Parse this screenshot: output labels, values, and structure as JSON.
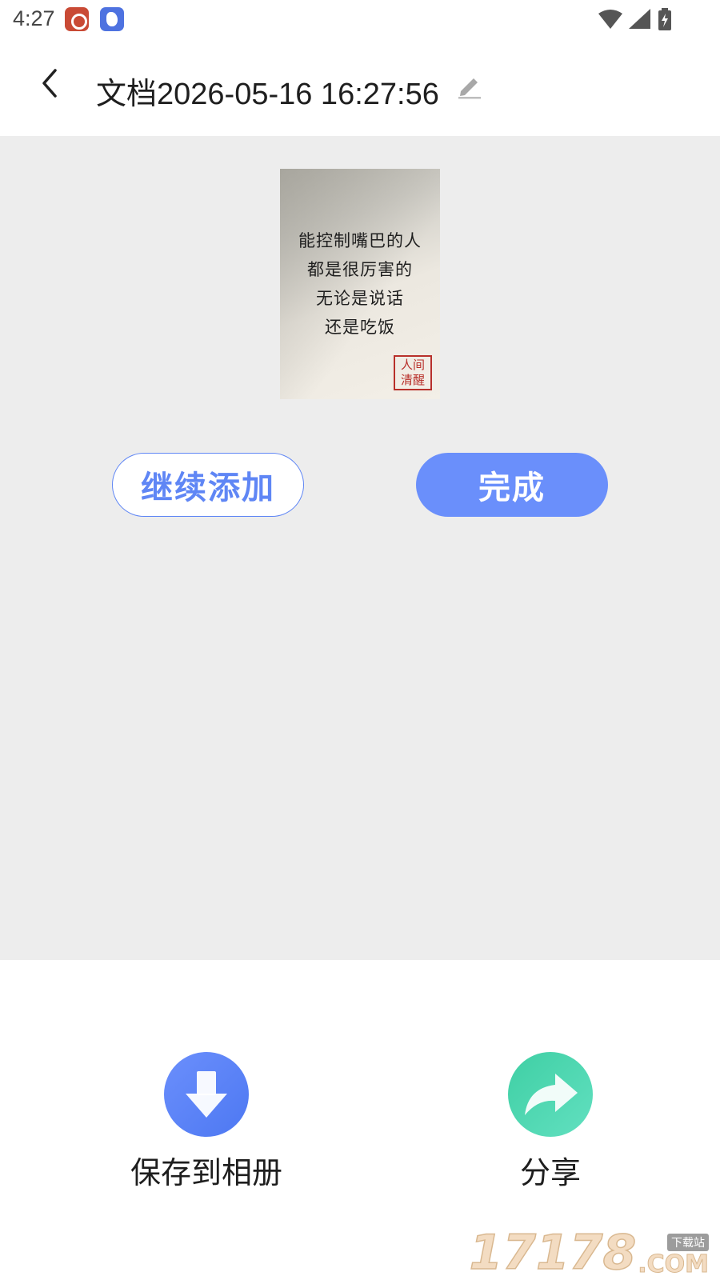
{
  "status_bar": {
    "time": "4:27",
    "icons": [
      "weibo-icon",
      "bird-app-icon",
      "wifi-icon",
      "signal-icon",
      "battery-charging-icon"
    ]
  },
  "header": {
    "title": "文档2026-05-16 16:27:56",
    "back_icon": "chevron-left-icon",
    "edit_icon": "pencil-icon"
  },
  "thumbnail": {
    "lines": [
      "能控制嘴巴的人",
      "都是很厉害的",
      "无论是说话",
      "还是吃饭"
    ],
    "seal": [
      "人间",
      "清醒"
    ]
  },
  "buttons": {
    "continue_add": "继续添加",
    "done": "完成"
  },
  "actions": {
    "save_label": "保存到相册",
    "share_label": "分享"
  },
  "watermark": {
    "digits": "17178",
    "tag": "下载站",
    "domain": ".COM"
  },
  "colors": {
    "accent_blue": "#6a8ffb",
    "share_green": "#3fcfa4",
    "main_background": "#ededed"
  }
}
